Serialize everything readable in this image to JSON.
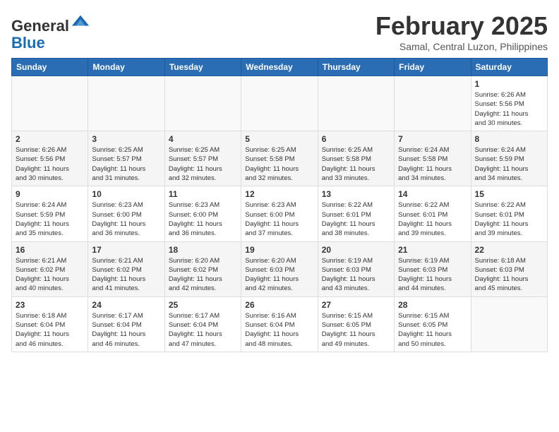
{
  "header": {
    "logo_general": "General",
    "logo_blue": "Blue",
    "month_year": "February 2025",
    "location": "Samal, Central Luzon, Philippines"
  },
  "calendar": {
    "days_of_week": [
      "Sunday",
      "Monday",
      "Tuesday",
      "Wednesday",
      "Thursday",
      "Friday",
      "Saturday"
    ],
    "weeks": [
      [
        {
          "day": "",
          "info": ""
        },
        {
          "day": "",
          "info": ""
        },
        {
          "day": "",
          "info": ""
        },
        {
          "day": "",
          "info": ""
        },
        {
          "day": "",
          "info": ""
        },
        {
          "day": "",
          "info": ""
        },
        {
          "day": "1",
          "info": "Sunrise: 6:26 AM\nSunset: 5:56 PM\nDaylight: 11 hours\nand 30 minutes."
        }
      ],
      [
        {
          "day": "2",
          "info": "Sunrise: 6:26 AM\nSunset: 5:56 PM\nDaylight: 11 hours\nand 30 minutes."
        },
        {
          "day": "3",
          "info": "Sunrise: 6:25 AM\nSunset: 5:57 PM\nDaylight: 11 hours\nand 31 minutes."
        },
        {
          "day": "4",
          "info": "Sunrise: 6:25 AM\nSunset: 5:57 PM\nDaylight: 11 hours\nand 32 minutes."
        },
        {
          "day": "5",
          "info": "Sunrise: 6:25 AM\nSunset: 5:58 PM\nDaylight: 11 hours\nand 32 minutes."
        },
        {
          "day": "6",
          "info": "Sunrise: 6:25 AM\nSunset: 5:58 PM\nDaylight: 11 hours\nand 33 minutes."
        },
        {
          "day": "7",
          "info": "Sunrise: 6:24 AM\nSunset: 5:58 PM\nDaylight: 11 hours\nand 34 minutes."
        },
        {
          "day": "8",
          "info": "Sunrise: 6:24 AM\nSunset: 5:59 PM\nDaylight: 11 hours\nand 34 minutes."
        }
      ],
      [
        {
          "day": "9",
          "info": "Sunrise: 6:24 AM\nSunset: 5:59 PM\nDaylight: 11 hours\nand 35 minutes."
        },
        {
          "day": "10",
          "info": "Sunrise: 6:23 AM\nSunset: 6:00 PM\nDaylight: 11 hours\nand 36 minutes."
        },
        {
          "day": "11",
          "info": "Sunrise: 6:23 AM\nSunset: 6:00 PM\nDaylight: 11 hours\nand 36 minutes."
        },
        {
          "day": "12",
          "info": "Sunrise: 6:23 AM\nSunset: 6:00 PM\nDaylight: 11 hours\nand 37 minutes."
        },
        {
          "day": "13",
          "info": "Sunrise: 6:22 AM\nSunset: 6:01 PM\nDaylight: 11 hours\nand 38 minutes."
        },
        {
          "day": "14",
          "info": "Sunrise: 6:22 AM\nSunset: 6:01 PM\nDaylight: 11 hours\nand 39 minutes."
        },
        {
          "day": "15",
          "info": "Sunrise: 6:22 AM\nSunset: 6:01 PM\nDaylight: 11 hours\nand 39 minutes."
        }
      ],
      [
        {
          "day": "16",
          "info": "Sunrise: 6:21 AM\nSunset: 6:02 PM\nDaylight: 11 hours\nand 40 minutes."
        },
        {
          "day": "17",
          "info": "Sunrise: 6:21 AM\nSunset: 6:02 PM\nDaylight: 11 hours\nand 41 minutes."
        },
        {
          "day": "18",
          "info": "Sunrise: 6:20 AM\nSunset: 6:02 PM\nDaylight: 11 hours\nand 42 minutes."
        },
        {
          "day": "19",
          "info": "Sunrise: 6:20 AM\nSunset: 6:03 PM\nDaylight: 11 hours\nand 42 minutes."
        },
        {
          "day": "20",
          "info": "Sunrise: 6:19 AM\nSunset: 6:03 PM\nDaylight: 11 hours\nand 43 minutes."
        },
        {
          "day": "21",
          "info": "Sunrise: 6:19 AM\nSunset: 6:03 PM\nDaylight: 11 hours\nand 44 minutes."
        },
        {
          "day": "22",
          "info": "Sunrise: 6:18 AM\nSunset: 6:03 PM\nDaylight: 11 hours\nand 45 minutes."
        }
      ],
      [
        {
          "day": "23",
          "info": "Sunrise: 6:18 AM\nSunset: 6:04 PM\nDaylight: 11 hours\nand 46 minutes."
        },
        {
          "day": "24",
          "info": "Sunrise: 6:17 AM\nSunset: 6:04 PM\nDaylight: 11 hours\nand 46 minutes."
        },
        {
          "day": "25",
          "info": "Sunrise: 6:17 AM\nSunset: 6:04 PM\nDaylight: 11 hours\nand 47 minutes."
        },
        {
          "day": "26",
          "info": "Sunrise: 6:16 AM\nSunset: 6:04 PM\nDaylight: 11 hours\nand 48 minutes."
        },
        {
          "day": "27",
          "info": "Sunrise: 6:15 AM\nSunset: 6:05 PM\nDaylight: 11 hours\nand 49 minutes."
        },
        {
          "day": "28",
          "info": "Sunrise: 6:15 AM\nSunset: 6:05 PM\nDaylight: 11 hours\nand 50 minutes."
        },
        {
          "day": "",
          "info": ""
        }
      ]
    ]
  }
}
